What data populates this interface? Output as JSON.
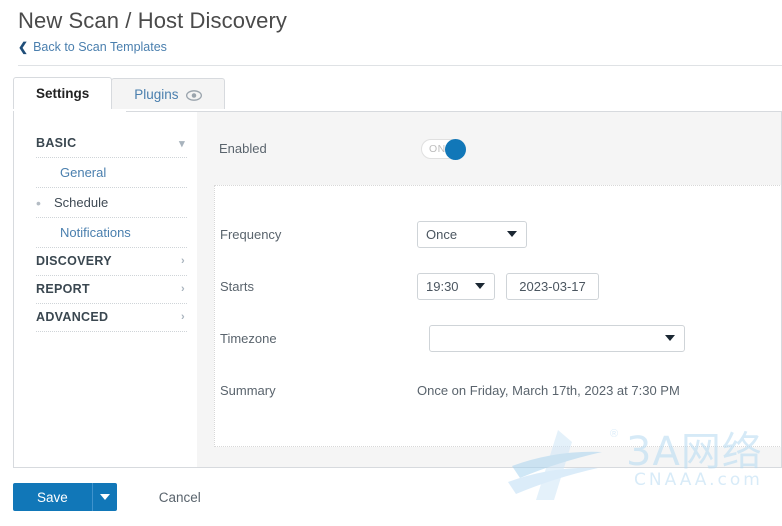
{
  "header": {
    "title": "New Scan / Host Discovery",
    "back_link": "Back to Scan Templates",
    "back_icon": "chevron-left-icon"
  },
  "tabs": [
    {
      "label": "Settings",
      "active": true,
      "icon": null
    },
    {
      "label": "Plugins",
      "active": false,
      "icon": "eye-icon"
    }
  ],
  "sidebar": {
    "groups": [
      {
        "label": "BASIC",
        "expanded": true,
        "icon": "chevron-down-icon",
        "items": [
          {
            "label": "General",
            "active": false
          },
          {
            "label": "Schedule",
            "active": true
          },
          {
            "label": "Notifications",
            "active": false
          }
        ]
      },
      {
        "label": "DISCOVERY",
        "expanded": false,
        "icon": "chevron-right-icon",
        "items": []
      },
      {
        "label": "REPORT",
        "expanded": false,
        "icon": "chevron-right-icon",
        "items": []
      },
      {
        "label": "ADVANCED",
        "expanded": false,
        "icon": "chevron-right-icon",
        "items": []
      }
    ]
  },
  "form": {
    "enabled": {
      "label": "Enabled",
      "toggle_text": "ON",
      "state": "on"
    },
    "frequency": {
      "label": "Frequency",
      "value": "Once"
    },
    "starts": {
      "label": "Starts",
      "time_value": "19:30",
      "date_value": "2023-03-17"
    },
    "timezone": {
      "label": "Timezone",
      "value": "",
      "highlighted": true
    },
    "summary": {
      "label": "Summary",
      "value": "Once on Friday, March 17th, 2023 at 7:30 PM"
    }
  },
  "footer": {
    "save_label": "Save",
    "save_dropdown_icon": "caret-down-icon",
    "cancel_label": "Cancel"
  },
  "watermark": {
    "text": "3A网络",
    "subtext": "CNAAA.com",
    "registered": "®"
  },
  "colors": {
    "accent_blue": "#1177b8",
    "link_blue": "#4a7fae",
    "highlight_red": "#e21b1b",
    "panel_grey": "#f5f5f5"
  }
}
